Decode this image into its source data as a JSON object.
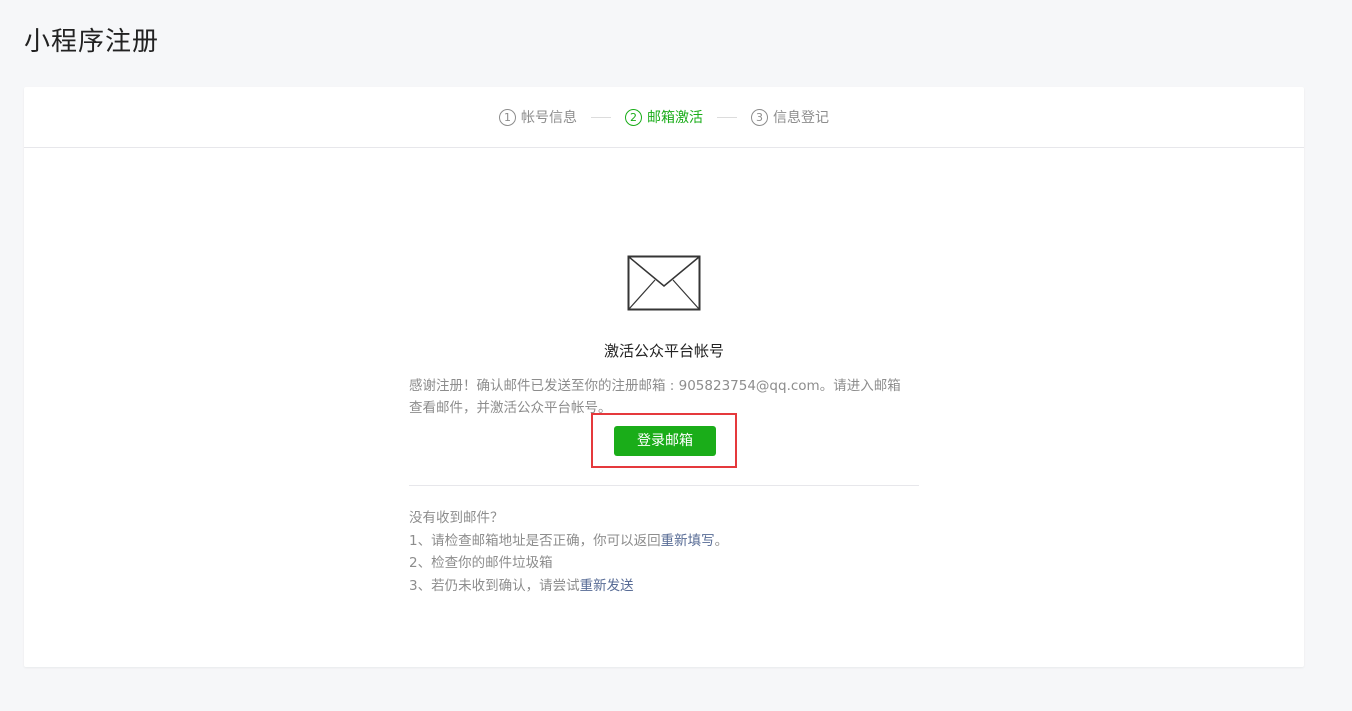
{
  "page": {
    "title": "小程序注册"
  },
  "steps": [
    {
      "num": "1",
      "label": "帐号信息",
      "active": false
    },
    {
      "num": "2",
      "label": "邮箱激活",
      "active": true
    },
    {
      "num": "3",
      "label": "信息登记",
      "active": false
    }
  ],
  "activation": {
    "icon": "envelope-icon",
    "title": "激活公众平台帐号",
    "desc_line1": "感谢注册！确认邮件已发送至你的注册邮箱 : 905823754@qq.com。请进入邮箱",
    "desc_line2": "查看邮件，并激活公众平台帐号。",
    "button_label": "登录邮箱"
  },
  "help": {
    "heading": "没有收到邮件？",
    "item1_prefix": "1、请检查邮箱地址是否正确，你可以返回",
    "item1_link": "重新填写",
    "item1_suffix": "。",
    "item2": "2、检查你的邮件垃圾箱",
    "item3_prefix": "3、若仍未收到确认，请尝试",
    "item3_link": "重新发送"
  },
  "colors": {
    "accent_green": "#1aad19",
    "link_blue": "#576b95",
    "highlight_red": "#e5393c"
  }
}
